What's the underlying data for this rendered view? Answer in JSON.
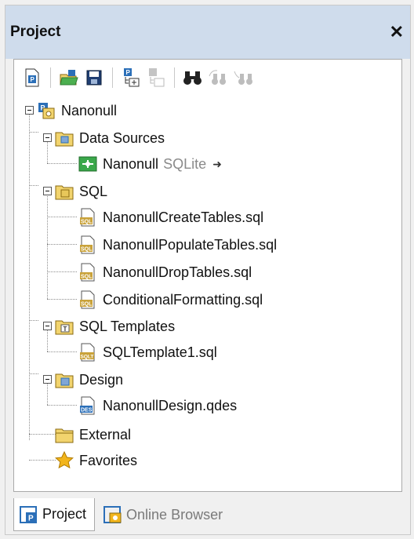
{
  "panel": {
    "title": "Project"
  },
  "toolbar": {
    "buttons": [
      {
        "name": "new-project-icon"
      },
      {
        "name": "open-project-icon"
      },
      {
        "name": "save-project-icon"
      },
      {
        "name": "add-files-icon"
      },
      {
        "name": "add-active-file-icon"
      },
      {
        "name": "find-icon"
      },
      {
        "name": "find-next-icon"
      },
      {
        "name": "replace-icon"
      }
    ]
  },
  "tree": {
    "root": "Nanonull",
    "data_sources": {
      "label": "Data Sources",
      "items": [
        {
          "label": "Nanonull",
          "sub": "SQLite"
        }
      ]
    },
    "sql": {
      "label": "SQL",
      "items": [
        "NanonullCreateTables.sql",
        "NanonullPopulateTables.sql",
        "NanonullDropTables.sql",
        "ConditionalFormatting.sql"
      ]
    },
    "sql_templates": {
      "label": "SQL Templates",
      "items": [
        "SQLTemplate1.sql"
      ]
    },
    "design": {
      "label": "Design",
      "items": [
        "NanonullDesign.qdes"
      ]
    },
    "external": "External",
    "favorites": "Favorites"
  },
  "tabs": [
    {
      "label": "Project",
      "active": true
    },
    {
      "label": "Online Browser",
      "active": false
    }
  ],
  "colors": {
    "titlebar": "#cfdcec",
    "folder": "#f2d46e",
    "sql_icon": "#c9a23a",
    "accent_blue": "#2b6fb8",
    "connection_green": "#3aa84a",
    "star": "#f2b51c"
  }
}
